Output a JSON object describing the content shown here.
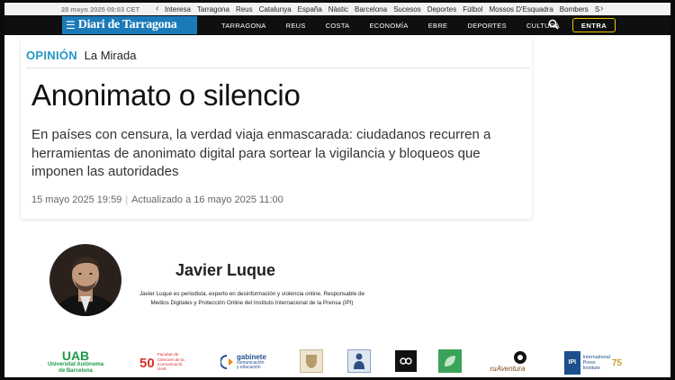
{
  "top_strip": {
    "date": "28 mayo 2025  09:03 CET",
    "items": [
      "Interesa",
      "Tarragona",
      "Reus",
      "Catalunya",
      "España",
      "Nàstic",
      "Barcelona",
      "Sucesos",
      "Deportes",
      "Fútbol",
      "Mossos D'Esquadra",
      "Bombers",
      "S"
    ]
  },
  "nav": {
    "logo": "Diari de Tarragona",
    "items": [
      "TARRAGONA",
      "REUS",
      "COSTA",
      "ECONOMÍA",
      "EBRE",
      "DEPORTES",
      "CULTURA"
    ],
    "login_label": "ENTRA"
  },
  "article": {
    "section": "OPINIÓN",
    "column": "La Mirada",
    "title": "Anonimato o silencio",
    "subtitle": "En países con censura, la verdad viaja enmascarada: ciudadanos recurren a herramientas de anonimato digital para sortear la vigilancia y bloqueos que imponen las autoridades",
    "published": "15 mayo 2025 19:59",
    "updated": "Actualizado a 16 mayo 2025 11:00"
  },
  "author": {
    "name": "Javier Luque",
    "bio": "Javier Luque es periodista, experto en desinformación y violencia online. Responsable de Medios Digitales y Protección Online del Instituto Internacional de la Prensa (IPI)"
  },
  "partners": {
    "uab_title": "UAB",
    "uab_sub1": "Universitat Autònoma",
    "uab_sub2": "de Barcelona",
    "fcc_number": "50",
    "fcc_text1": "Facultat de",
    "fcc_text2": "Ciències de la",
    "fcc_text3": "Comunicació",
    "fcc_text4": "UAB",
    "gabinete_title": "gabinete",
    "gabinete_sub1": "comunicación",
    "gabinete_sub2": "y educación",
    "ruaventura": "ruAventura",
    "ipi_label1": "International",
    "ipi_label2": "Press",
    "ipi_label3": "Institute",
    "ipi_years": "75",
    "ipi_short": "IPI"
  },
  "colors": {
    "accent": "#2796c9",
    "logo_bg": "#1a7ab8",
    "nav_bg": "#0f0f0f",
    "login_border": "#f2c200",
    "uab_green": "#1c9a48"
  }
}
